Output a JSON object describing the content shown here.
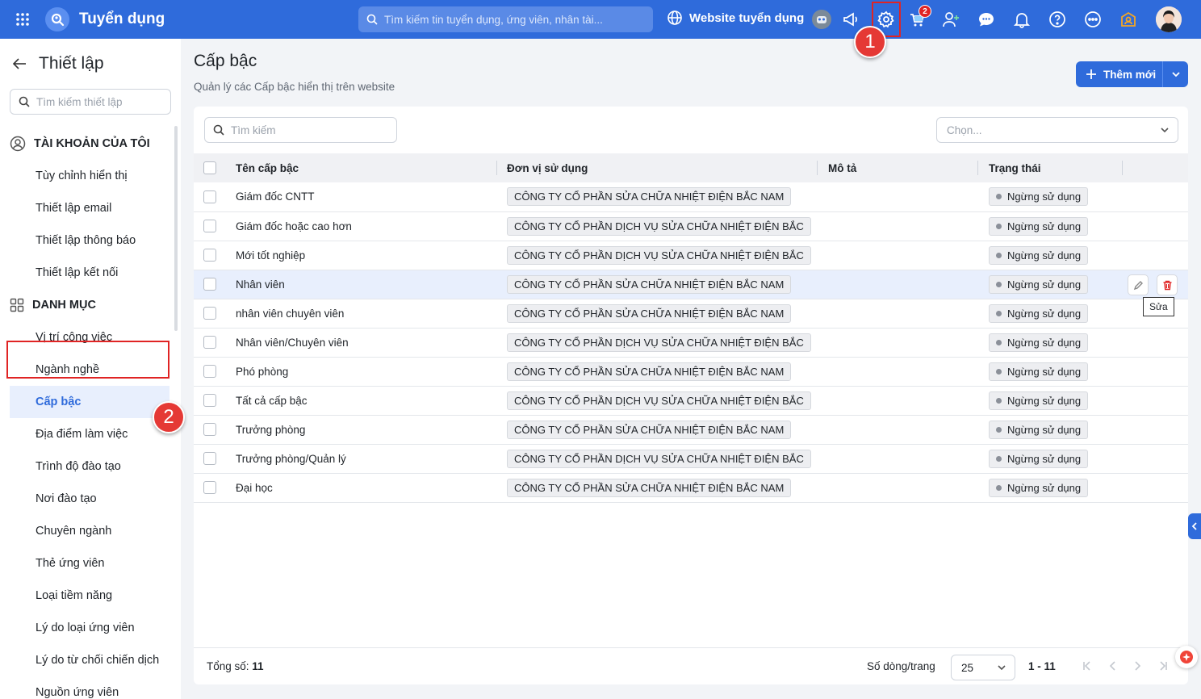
{
  "app": {
    "title": "Tuyển dụng",
    "search_placeholder": "Tìm kiếm tin tuyển dụng, ứng viên, nhân tài...",
    "website_link": "Website tuyển dụng",
    "cart_badge": "2"
  },
  "steps": {
    "one": "1",
    "two": "2"
  },
  "sidebar": {
    "title": "Thiết lập",
    "search_placeholder": "Tìm kiếm thiết lập",
    "section_account": "TÀI KHOẢN CỦA TÔI",
    "account_items": [
      "Tùy chỉnh hiển thị",
      "Thiết lập email",
      "Thiết lập thông báo",
      "Thiết lập kết nối"
    ],
    "section_catalog": "DANH MỤC",
    "catalog_items": [
      "Vị trí công việc",
      "Ngành nghề",
      "Cấp bậc",
      "Địa điểm làm việc",
      "Trình độ đào tạo",
      "Nơi đào tạo",
      "Chuyên ngành",
      "Thẻ ứng viên",
      "Loại tiềm năng",
      "Lý do loại ứng viên",
      "Lý do từ chối chiến dịch",
      "Nguồn ứng viên"
    ]
  },
  "page": {
    "title": "Cấp bậc",
    "subtitle": "Quản lý các Cấp bậc hiển thị trên website",
    "add_button": "Thêm mới"
  },
  "filters": {
    "search_placeholder": "Tìm kiếm",
    "select_placeholder": "Chọn..."
  },
  "table": {
    "headers": [
      "Tên cấp bậc",
      "Đơn vị sử dụng",
      "Mô tả",
      "Trạng thái"
    ],
    "rows": [
      {
        "name": "Giám đốc CNTT",
        "unit": "CÔNG TY CỔ PHẦN SỬA CHỮA NHIỆT ĐIỆN BẮC NAM",
        "desc": "",
        "status": "Ngừng sử dụng"
      },
      {
        "name": "Giám đốc hoặc cao hơn",
        "unit": "CÔNG TY CỔ PHẦN DỊCH VỤ SỬA CHỮA NHIỆT ĐIỆN BẮC",
        "desc": "",
        "status": "Ngừng sử dụng"
      },
      {
        "name": "Mới tốt nghiệp",
        "unit": "CÔNG TY CỔ PHẦN DỊCH VỤ SỬA CHỮA NHIỆT ĐIỆN BẮC",
        "desc": "",
        "status": "Ngừng sử dụng"
      },
      {
        "name": "Nhân viên",
        "unit": "CÔNG TY CỔ PHẦN SỬA CHỮA NHIỆT ĐIỆN BẮC NAM",
        "desc": "",
        "status": "Ngừng sử dụng"
      },
      {
        "name": "nhân viên chuyên viên",
        "unit": "CÔNG TY CỔ PHẦN SỬA CHỮA NHIỆT ĐIỆN BẮC NAM",
        "desc": "",
        "status": "Ngừng sử dụng"
      },
      {
        "name": "Nhân viên/Chuyên viên",
        "unit": "CÔNG TY CỔ PHẦN DỊCH VỤ SỬA CHỮA NHIỆT ĐIỆN BẮC",
        "desc": "",
        "status": "Ngừng sử dụng"
      },
      {
        "name": "Phó phòng",
        "unit": "CÔNG TY CỔ PHẦN SỬA CHỮA NHIỆT ĐIỆN BẮC NAM",
        "desc": "",
        "status": "Ngừng sử dụng"
      },
      {
        "name": "Tất cả cấp bậc",
        "unit": "CÔNG TY CỔ PHẦN DỊCH VỤ SỬA CHỮA NHIỆT ĐIỆN BẮC",
        "desc": "",
        "status": "Ngừng sử dụng"
      },
      {
        "name": "Trưởng phòng",
        "unit": "CÔNG TY CỔ PHẦN SỬA CHỮA NHIỆT ĐIỆN BẮC NAM",
        "desc": "",
        "status": "Ngừng sử dụng"
      },
      {
        "name": "Trưởng phòng/Quản lý",
        "unit": "CÔNG TY CỔ PHẦN DỊCH VỤ SỬA CHỮA NHIỆT ĐIỆN BẮC",
        "desc": "",
        "status": "Ngừng sử dụng"
      },
      {
        "name": "Đại học",
        "unit": "CÔNG TY CỔ PHẦN SỬA CHỮA NHIỆT ĐIỆN BẮC NAM",
        "desc": "",
        "status": "Ngừng sử dụng"
      }
    ],
    "hover_tooltip": "Sửa"
  },
  "footer": {
    "total_label": "Tổng số:",
    "total_value": "11",
    "rows_label": "Số dòng/trang",
    "rows_value": "25",
    "range": "1 - 11"
  },
  "colors": {
    "primary": "#2f6bdb",
    "highlight": "#e02424",
    "status_dot": "#8b9099"
  }
}
